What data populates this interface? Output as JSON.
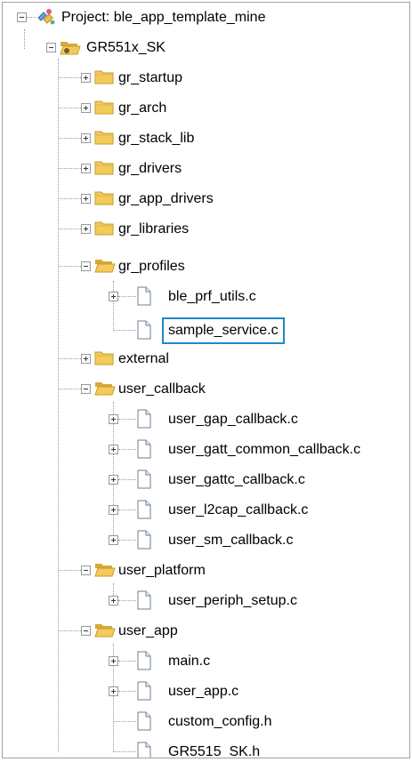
{
  "tree": {
    "rows": [
      {
        "label": "Project: ble_app_template_mine",
        "icon": "project-icon",
        "expander": "minus"
      },
      {
        "label": "GR551x_SK",
        "icon": "open-folder-icon",
        "expander": "minus"
      },
      {
        "label": "gr_startup",
        "icon": "folder-icon",
        "expander": "plus"
      },
      {
        "label": "gr_arch",
        "icon": "folder-icon",
        "expander": "plus"
      },
      {
        "label": "gr_stack_lib",
        "icon": "folder-icon",
        "expander": "plus"
      },
      {
        "label": "gr_drivers",
        "icon": "folder-icon",
        "expander": "plus"
      },
      {
        "label": "gr_app_drivers",
        "icon": "folder-icon",
        "expander": "plus"
      },
      {
        "label": "gr_libraries",
        "icon": "folder-icon",
        "expander": "plus"
      },
      {
        "label": "gr_profiles",
        "icon": "open-folder-icon",
        "expander": "minus"
      },
      {
        "label": "ble_prf_utils.c",
        "icon": "file-icon",
        "expander": "plus"
      },
      {
        "label": "sample_service.c",
        "icon": "file-icon",
        "expander": "none",
        "selected": true
      },
      {
        "label": "external",
        "icon": "folder-icon",
        "expander": "plus"
      },
      {
        "label": "user_callback",
        "icon": "open-folder-icon",
        "expander": "minus"
      },
      {
        "label": "user_gap_callback.c",
        "icon": "file-icon",
        "expander": "plus"
      },
      {
        "label": "user_gatt_common_callback.c",
        "icon": "file-icon",
        "expander": "plus"
      },
      {
        "label": "user_gattc_callback.c",
        "icon": "file-icon",
        "expander": "plus"
      },
      {
        "label": "user_l2cap_callback.c",
        "icon": "file-icon",
        "expander": "plus"
      },
      {
        "label": "user_sm_callback.c",
        "icon": "file-icon",
        "expander": "plus"
      },
      {
        "label": "user_platform",
        "icon": "open-folder-icon",
        "expander": "minus"
      },
      {
        "label": "user_periph_setup.c",
        "icon": "file-icon",
        "expander": "plus"
      },
      {
        "label": "user_app",
        "icon": "open-folder-icon",
        "expander": "minus"
      },
      {
        "label": "main.c",
        "icon": "file-icon",
        "expander": "plus"
      },
      {
        "label": "user_app.c",
        "icon": "file-icon",
        "expander": "plus"
      },
      {
        "label": "custom_config.h",
        "icon": "file-icon",
        "expander": "none"
      },
      {
        "label": "GR5515_SK.h",
        "icon": "file-icon",
        "expander": "none"
      }
    ]
  },
  "colors": {
    "selection_border": "#1e88c8",
    "folder_yellow": "#f2cb5a",
    "guide_lines": "#9a9a9a"
  }
}
